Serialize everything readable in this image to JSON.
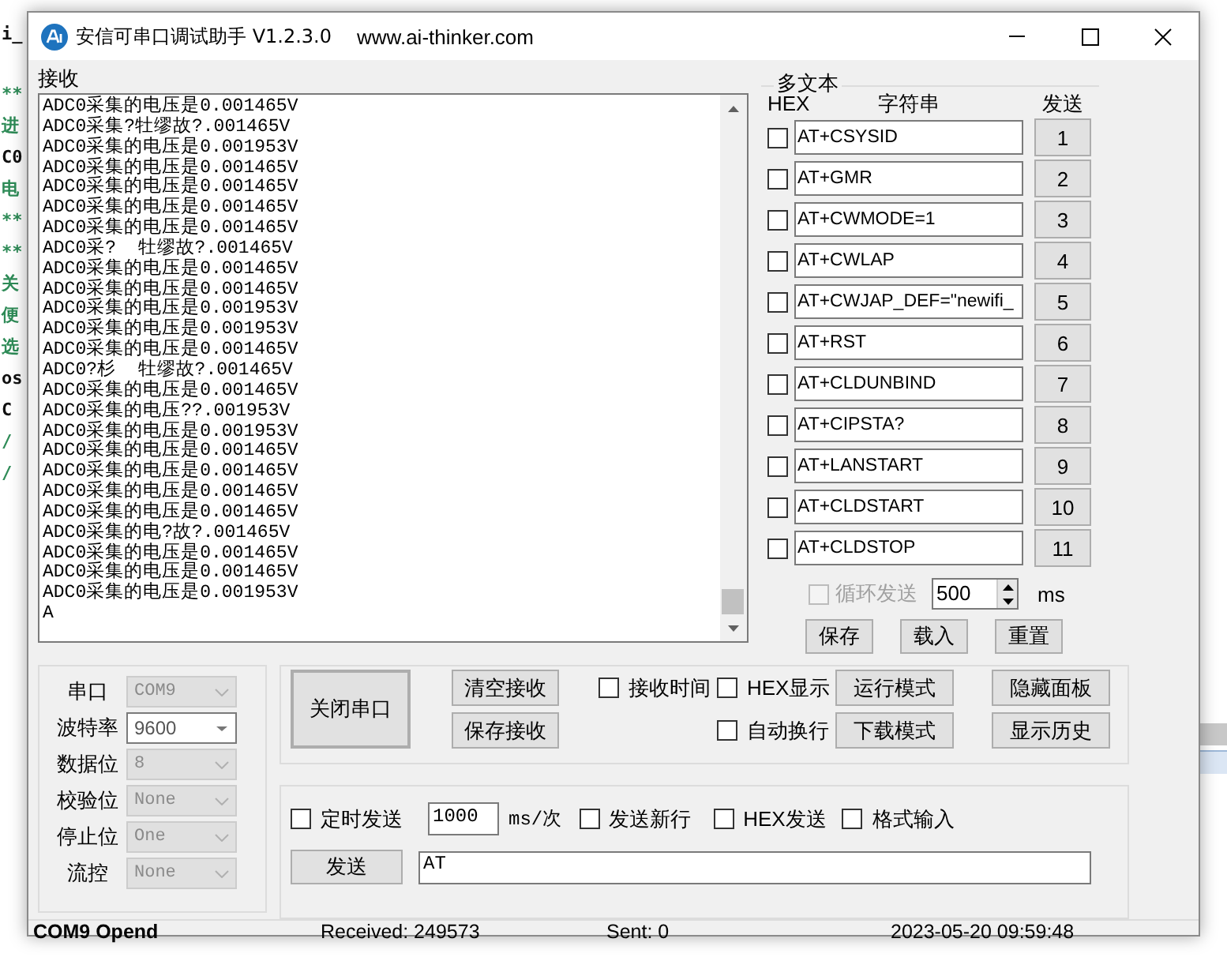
{
  "desktop": {
    "editor_lines": [
      {
        "text": "i_",
        "kind": "code"
      },
      {
        "text": "**",
        "kind": "comment"
      },
      {
        "text": "进",
        "kind": "comment"
      },
      {
        "text": "C0",
        "kind": "code"
      },
      {
        "text": "电",
        "kind": "comment"
      },
      {
        "text": "**",
        "kind": "comment"
      },
      {
        "text": "**",
        "kind": "comment"
      },
      {
        "text": "关",
        "kind": "comment"
      },
      {
        "text": "便",
        "kind": "comment"
      },
      {
        "text": "选",
        "kind": "comment"
      },
      {
        "text": "os",
        "kind": "code"
      },
      {
        "text": "C",
        "kind": "code"
      },
      {
        "text": "/",
        "kind": "comment"
      },
      {
        "text": "/",
        "kind": "comment"
      }
    ]
  },
  "window": {
    "title": "安信可串口调试助手 V1.2.3.0",
    "url": "www.ai-thinker.com"
  },
  "receive": {
    "label": "接收",
    "lines": [
      "ADC0采集的电压是0.001465V",
      "ADC0采集?牡缪故?.001465V",
      "ADC0采集的电压是0.001953V",
      "ADC0采集的电压是0.001465V",
      "ADC0采集的电压是0.001465V",
      "ADC0采集的电压是0.001465V",
      "ADC0采集的电压是0.001465V",
      "ADC0采?  牡缪故?.001465V",
      "ADC0采集的电压是0.001465V",
      "ADC0采集的电压是0.001465V",
      "ADC0采集的电压是0.001953V",
      "ADC0采集的电压是0.001953V",
      "ADC0采集的电压是0.001465V",
      "ADC0?杉  牡缪故?.001465V",
      "ADC0采集的电压是0.001465V",
      "ADC0采集的电压??.001953V",
      "ADC0采集的电压是0.001953V",
      "ADC0采集的电压是0.001465V",
      "ADC0采集的电压是0.001465V",
      "ADC0采集的电压是0.001465V",
      "ADC0采集的电压是0.001465V",
      "ADC0采集的电?故?.001465V",
      "ADC0采集的电压是0.001465V",
      "ADC0采集的电压是0.001465V",
      "ADC0采集的电压是0.001953V",
      "A"
    ]
  },
  "multi_text": {
    "label": "多文本",
    "col_hex": "HEX",
    "col_string": "字符串",
    "col_send": "发送",
    "rows": [
      {
        "hex": false,
        "text": "AT+CSYSID",
        "button": "1"
      },
      {
        "hex": false,
        "text": "AT+GMR",
        "button": "2"
      },
      {
        "hex": false,
        "text": "AT+CWMODE=1",
        "button": "3"
      },
      {
        "hex": false,
        "text": "AT+CWLAP",
        "button": "4"
      },
      {
        "hex": false,
        "text": "AT+CWJAP_DEF=\"newifi_",
        "button": "5"
      },
      {
        "hex": false,
        "text": "AT+RST",
        "button": "6"
      },
      {
        "hex": false,
        "text": "AT+CLDUNBIND",
        "button": "7"
      },
      {
        "hex": false,
        "text": "AT+CIPSTA?",
        "button": "8"
      },
      {
        "hex": false,
        "text": "AT+LANSTART",
        "button": "9"
      },
      {
        "hex": false,
        "text": "AT+CLDSTART",
        "button": "10"
      },
      {
        "hex": false,
        "text": "AT+CLDSTOP",
        "button": "11"
      }
    ],
    "loop_send": {
      "label": "循环发送",
      "checked": false,
      "disabled": true,
      "interval": "500",
      "unit": "ms"
    },
    "buttons": [
      "保存",
      "载入",
      "重置"
    ]
  },
  "port_settings": [
    {
      "label": "串口",
      "value": "COM9",
      "disabled": true
    },
    {
      "label": "波特率",
      "value": "9600",
      "disabled": false
    },
    {
      "label": "数据位",
      "value": "8",
      "disabled": true
    },
    {
      "label": "校验位",
      "value": "None",
      "disabled": true
    },
    {
      "label": "停止位",
      "value": "One",
      "disabled": true
    },
    {
      "label": "流控",
      "value": "None",
      "disabled": true
    }
  ],
  "controls": {
    "port_button": "关闭串口",
    "receive_buttons": [
      "清空接收",
      "保存接收"
    ],
    "options": [
      {
        "label": "接收时间",
        "checked": false
      },
      {
        "label": "HEX显示",
        "checked": false
      },
      {
        "label": "自动换行",
        "checked": false
      }
    ],
    "mode_buttons": [
      "运行模式",
      "下载模式"
    ],
    "panel_buttons": [
      "隐藏面板",
      "显示历史"
    ]
  },
  "send": {
    "timed": {
      "label": "定时发送",
      "checked": false
    },
    "interval": "1000",
    "interval_unit": "ms/次",
    "options": [
      {
        "label": "发送新行",
        "checked": false
      },
      {
        "label": "HEX发送",
        "checked": false
      },
      {
        "label": "格式输入",
        "checked": false
      }
    ],
    "send_button": "发送",
    "input": "AT"
  },
  "status_bar": {
    "port_status": "COM9 Opend",
    "received": "Received: 249573",
    "sent": "Sent: 0",
    "time": "2023-05-20 09:59:48"
  }
}
